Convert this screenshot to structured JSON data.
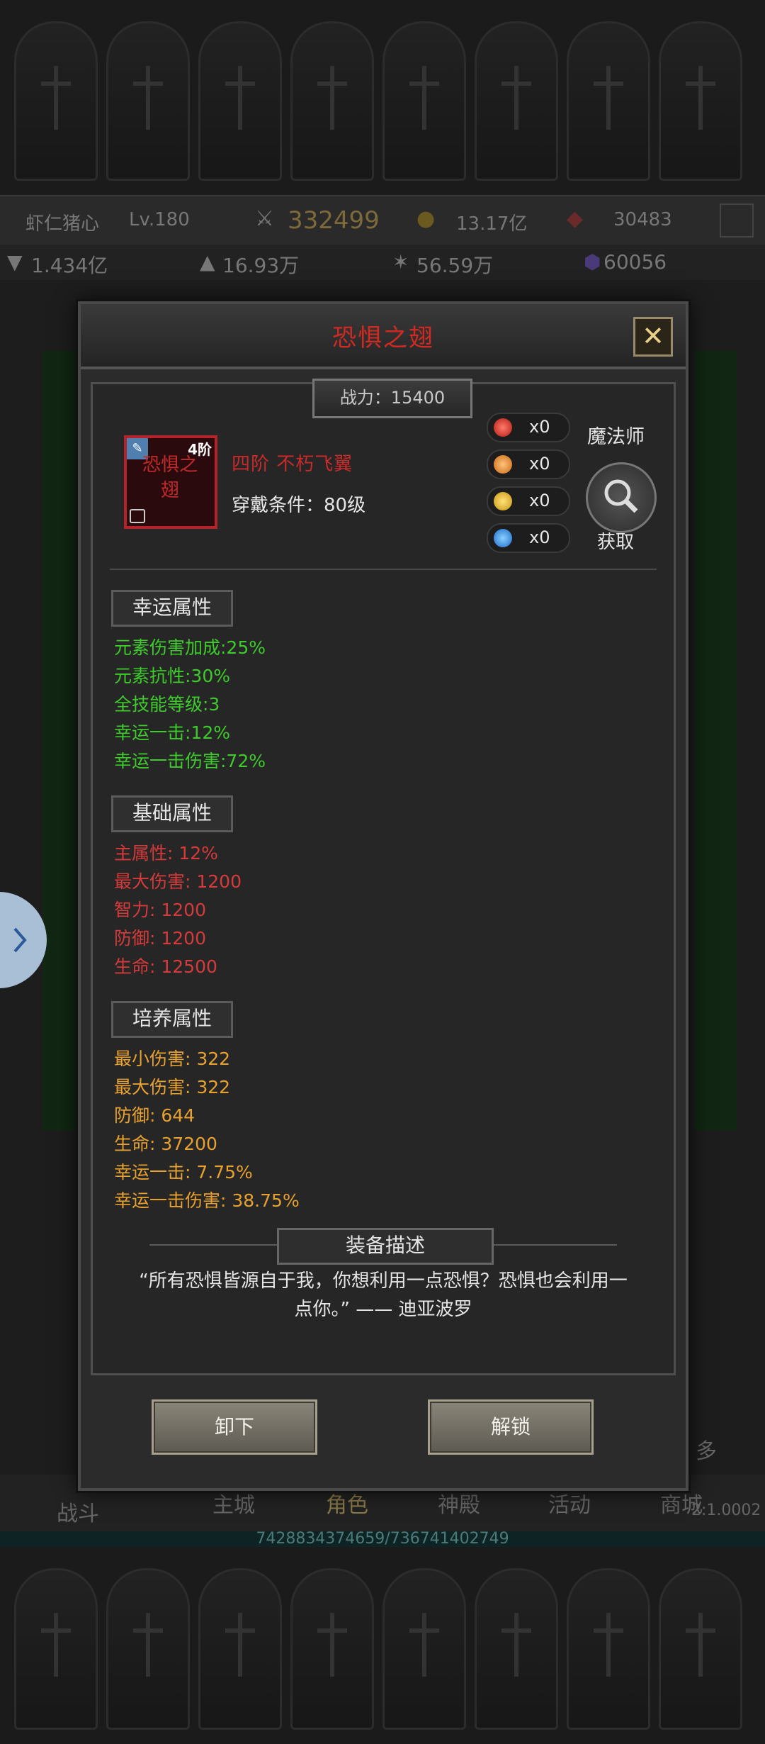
{
  "status_bar": {
    "player_name": "虾仁猪心",
    "level": "Lv.180",
    "combat_power": "332499",
    "gold": "13.17亿",
    "gems": "30483"
  },
  "resources": {
    "res1": "1.434亿",
    "res2": "16.93万",
    "res3": "56.59万",
    "res4": "60056"
  },
  "bottom_nav": {
    "battle": "战斗",
    "city": "主城",
    "role": "角色",
    "temple": "神殿",
    "activity": "活动",
    "shop": "商城",
    "more": "多",
    "ratio": "2:1.0002"
  },
  "progress_text": "7428834374659/736741402749",
  "modal": {
    "title": "恐惧之翅",
    "power": "战力：15400",
    "item": {
      "icon_name": "恐惧之翅",
      "tier": "4阶",
      "title": "四阶  不朽飞翼",
      "requirement": "穿戴条件：80级"
    },
    "gems": [
      {
        "color": "#d12a1e",
        "count": "x0"
      },
      {
        "color": "#e3841e",
        "count": "x0"
      },
      {
        "color": "#e8b21c",
        "count": "x0"
      },
      {
        "color": "#2a8be0",
        "count": "x0"
      }
    ],
    "class_label": "魔法师",
    "obtain_label": "获取",
    "lucky": {
      "heading": "幸运属性",
      "items": [
        "元素伤害加成:25%",
        "元素抗性:30%",
        "全技能等级:3",
        "幸运一击:12%",
        "幸运一击伤害:72%"
      ]
    },
    "basic": {
      "heading": "基础属性",
      "items": [
        "主属性: 12%",
        "最大伤害: 1200",
        "智力: 1200",
        "防御: 1200",
        "生命: 12500"
      ]
    },
    "cultivate": {
      "heading": "培养属性",
      "items": [
        "最小伤害: 322",
        "最大伤害: 322",
        "防御: 644",
        "生命: 37200",
        "幸运一击: 7.75%",
        "幸运一击伤害: 38.75%"
      ]
    },
    "description": {
      "heading": "装备描述",
      "text": "“所有恐惧皆源自于我，你想利用一点恐惧？恐惧也会利用一点你。” —— 迪亚波罗"
    },
    "buttons": {
      "unequip": "卸下",
      "unlock": "解锁"
    }
  }
}
